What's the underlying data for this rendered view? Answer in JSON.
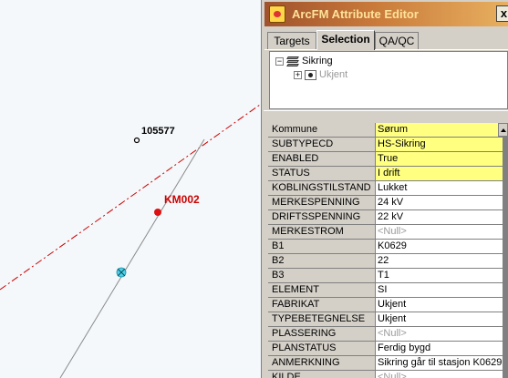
{
  "map": {
    "point_label": "105577",
    "station_label": "KM002"
  },
  "editor": {
    "title": "ArcFM Attribute Editor",
    "close": "x",
    "tabs": [
      {
        "label": "Targets"
      },
      {
        "label": "Selection"
      },
      {
        "label": "QA/QC"
      }
    ],
    "tree": {
      "layer": "Sikring",
      "feature": "Ukjent",
      "collapse": "−",
      "expand": "+"
    },
    "attributes": [
      {
        "name": "Kommune",
        "value": "Sørum",
        "required": true
      },
      {
        "name": "SUBTYPECD",
        "value": "HS-Sikring",
        "required": true
      },
      {
        "name": "ENABLED",
        "value": "True",
        "required": true
      },
      {
        "name": "STATUS",
        "value": "I drift",
        "required": true
      },
      {
        "name": "KOBLINGSTILSTAND",
        "value": "Lukket"
      },
      {
        "name": "MERKESPENNING",
        "value": "24 kV"
      },
      {
        "name": "DRIFTSSPENNING",
        "value": "22 kV"
      },
      {
        "name": "MERKESTROM",
        "value": "<Null>",
        "null": true
      },
      {
        "name": "B1",
        "value": "K0629"
      },
      {
        "name": "B2",
        "value": "22"
      },
      {
        "name": "B3",
        "value": "T1"
      },
      {
        "name": "ELEMENT",
        "value": "SI"
      },
      {
        "name": "FABRIKAT",
        "value": "Ukjent"
      },
      {
        "name": "TYPEBETEGNELSE",
        "value": "Ukjent"
      },
      {
        "name": "PLASSERING",
        "value": "<Null>",
        "null": true
      },
      {
        "name": "PLANSTATUS",
        "value": "Ferdig bygd"
      },
      {
        "name": "ANMERKNING",
        "value": "Sikring går til stasjon K0629"
      },
      {
        "name": "KILDE",
        "value": "<Null>",
        "null": true
      }
    ]
  },
  "colors": {
    "required_field": "#ffff80",
    "map_background": "#f4f8fb",
    "station_red": "#cc0000",
    "cable_dashed": "#cc0000",
    "line_gray": "#8a8a8a",
    "junction_cyan": "#4fd0e6"
  }
}
